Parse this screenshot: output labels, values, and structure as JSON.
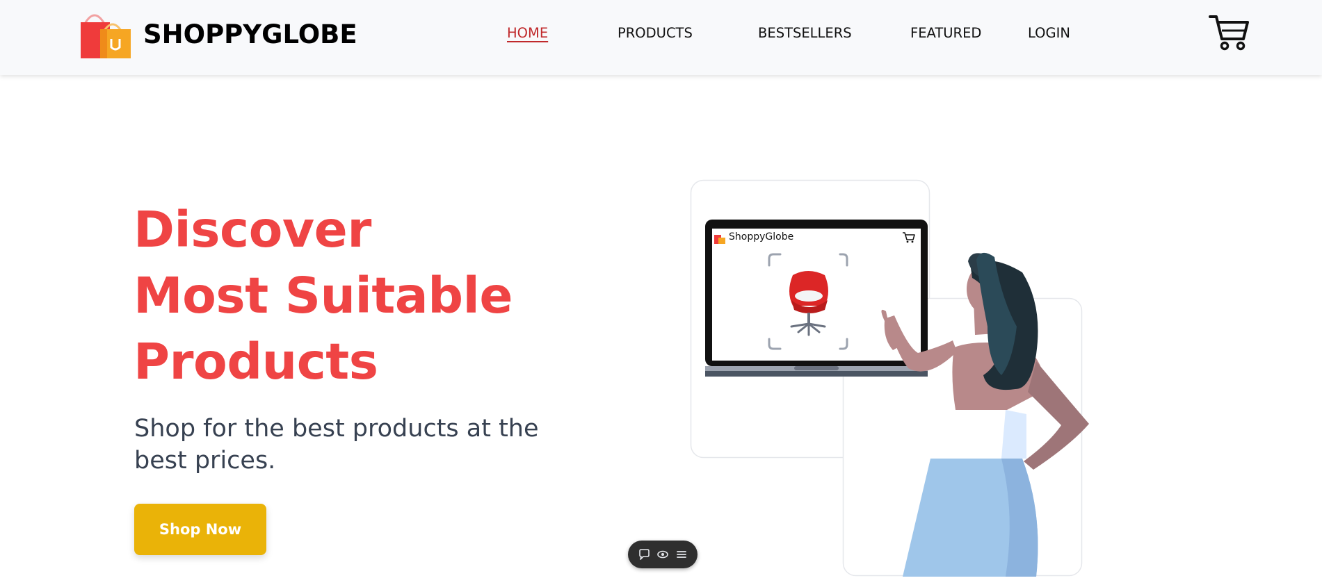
{
  "header": {
    "brand_name": "SHOPPYGLOBE",
    "nav": [
      {
        "label": "HOME",
        "active": true
      },
      {
        "label": "PRODUCTS",
        "active": false
      },
      {
        "label": "BESTSELLERS",
        "active": false
      },
      {
        "label": "FEATURED",
        "active": false
      },
      {
        "label": "LOGIN",
        "active": false
      }
    ],
    "cart_icon": "cart-icon",
    "logo_icon": "shopping-bags-icon"
  },
  "hero": {
    "title_lines": [
      "Discover",
      "Most Suitable",
      "Products"
    ],
    "subtitle": "Shop for the best products at the best prices.",
    "cta_label": "Shop Now"
  },
  "illustration": {
    "laptop_brand": "ShoppyGlobe",
    "product_icon": "red-chair-icon",
    "laptop_cart_icon": "cart-icon"
  },
  "float_toolbar": {
    "icons": [
      "comment-icon",
      "eye-icon",
      "menu-icon"
    ]
  },
  "colors": {
    "accent": "#ef4444",
    "nav_active": "#c0292b",
    "cta": "#eab308",
    "header_bg": "#f8f9fb",
    "subtitle": "#374151"
  }
}
